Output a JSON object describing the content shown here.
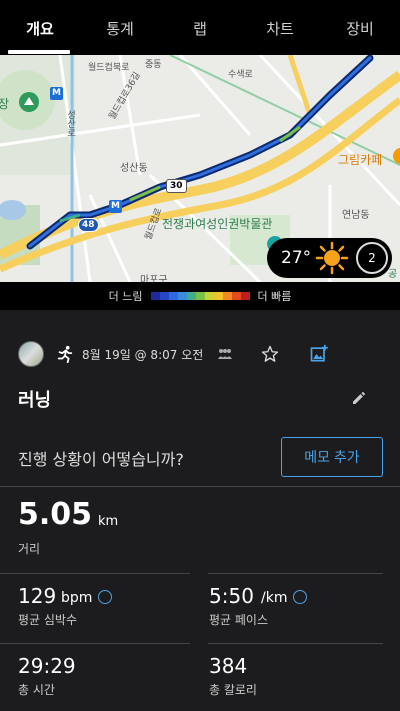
{
  "tabs": [
    {
      "label": "개요",
      "active": true
    },
    {
      "label": "통계",
      "active": false
    },
    {
      "label": "랩",
      "active": false
    },
    {
      "label": "차트",
      "active": false
    },
    {
      "label": "장비",
      "active": false
    }
  ],
  "map": {
    "labels": {
      "place_museum": "전쟁과여성인권박물관",
      "place_cafe": "그림카페",
      "dong_seongsan": "성산동",
      "dong_yeonnam": "연남동",
      "gu_mapo": "마포구",
      "road_world_cup_36": "월드컵로36길",
      "road_world_cup": "월드컵로",
      "road_susaek": "수색로",
      "road_seongsan": "성산로",
      "road_top_left": "증산로",
      "road_jungdong": "중동",
      "jang": "장",
      "gong": "공",
      "world_cup_buk": "월드컵북로"
    },
    "shields": {
      "route_30": "30",
      "route_48": "48"
    },
    "metro_label": "M",
    "google_logo": "Google",
    "weather": {
      "temperature": "27°",
      "wind_speed": "2"
    }
  },
  "legend": {
    "slow": "더 느림",
    "fast": "더 빠름",
    "colors": [
      "#1a2c9e",
      "#2446c8",
      "#2e6be0",
      "#3b8bd8",
      "#3fae8a",
      "#7bc043",
      "#c7d23a",
      "#f2c12e",
      "#f08a24",
      "#e24b1f",
      "#c21e1e"
    ]
  },
  "activity": {
    "date_time": "8월 19일 @ 8:07 오전",
    "title": "러닝",
    "progress_question": "진행 상황이 어떻습니까?",
    "memo_button": "메모 추가",
    "distance": {
      "value": "5.05",
      "unit": "km",
      "label": "거리"
    },
    "avg_hr": {
      "value": "129",
      "unit": "bpm",
      "label": "평균 심박수"
    },
    "avg_pace": {
      "value": "5:50",
      "unit": "/km",
      "label": "평균 페이스"
    },
    "total_time": {
      "value": "29:29",
      "label": "총 시간"
    },
    "calories": {
      "value": "384",
      "label": "총 칼로리"
    }
  }
}
